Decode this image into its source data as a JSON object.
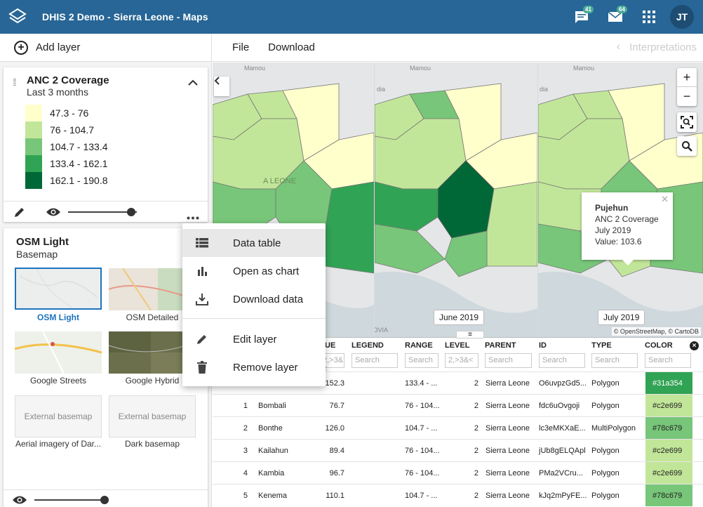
{
  "app": {
    "title": "DHIS 2 Demo - Sierra Leone - Maps",
    "messages_count": "41",
    "mail_count": "64",
    "user_initials": "JT"
  },
  "left_panel": {
    "add_layer": "Add layer",
    "thematic_layer": {
      "title": "ANC 2 Coverage",
      "period": "Last 3 months",
      "legend": [
        {
          "label": "47.3 - 76",
          "color": "#ffffcc"
        },
        {
          "label": "76 - 104.7",
          "color": "#c2e699"
        },
        {
          "label": "104.7 - 133.4",
          "color": "#78c679"
        },
        {
          "label": "133.4 - 162.1",
          "color": "#31a354"
        },
        {
          "label": "162.1 - 190.8",
          "color": "#006837"
        }
      ]
    },
    "basemap_card": {
      "title": "OSM Light",
      "subtitle": "Basemap",
      "basemaps": [
        {
          "label": "OSM Light",
          "selected": true
        },
        {
          "label": "OSM Detailed"
        },
        {
          "label": "Google Streets"
        },
        {
          "label": "Google Hybrid"
        },
        {
          "label": "Aerial imagery of Dar...",
          "thumb_text": "External basemap"
        },
        {
          "label": "Dark basemap",
          "thumb_text": "External basemap"
        }
      ]
    }
  },
  "toolbar": {
    "file": "File",
    "download": "Download",
    "interpretations": "Interpretations"
  },
  "context_menu": {
    "items": [
      {
        "label": "Data table",
        "icon": "table-icon"
      },
      {
        "label": "Open as chart",
        "icon": "chart-icon"
      },
      {
        "label": "Download data",
        "icon": "download-icon"
      },
      {
        "label": "Edit layer",
        "icon": "pencil-icon"
      },
      {
        "label": "Remove layer",
        "icon": "trash-icon"
      }
    ]
  },
  "map": {
    "periods": [
      "June 2019",
      "July 2019"
    ],
    "place_labels": {
      "mamou": "Mamou",
      "monrovia": "MONROVIA",
      "dia": "dia",
      "leone": "A LEONE"
    },
    "attribution": "© OpenStreetMap, © CartoDB",
    "popup": {
      "name": "Pujehun",
      "layer": "ANC 2 Coverage",
      "period": "July 2019",
      "value": "Value: 103.6"
    }
  },
  "table": {
    "headers": [
      "UE",
      "LEGEND",
      "RANGE",
      "LEVEL",
      "PARENT",
      "ID",
      "TYPE",
      "COLOR"
    ],
    "filters": {
      "value": "2,>3&<",
      "legend": "Search",
      "range": "Search",
      "level": "2,>3&<",
      "parent": "Search",
      "id": "Search",
      "type": "Search",
      "color": "Search"
    },
    "rows": [
      {
        "index": "",
        "name": "",
        "value": "152.3",
        "range": "133.4 - ...",
        "level": "2",
        "parent": "Sierra Leone",
        "id": "O6uvpzGd5...",
        "type": "Polygon",
        "color": "#31a354"
      },
      {
        "index": "1",
        "name": "Bombali",
        "value": "76.7",
        "range": "76 - 104...",
        "level": "2",
        "parent": "Sierra Leone",
        "id": "fdc6uOvgoji",
        "type": "Polygon",
        "color": "#c2e699"
      },
      {
        "index": "2",
        "name": "Bonthe",
        "value": "126.0",
        "range": "104.7 - ...",
        "level": "2",
        "parent": "Sierra Leone",
        "id": "lc3eMKXaE...",
        "type": "MultiPolygon",
        "color": "#78c679"
      },
      {
        "index": "3",
        "name": "Kailahun",
        "value": "89.4",
        "range": "76 - 104...",
        "level": "2",
        "parent": "Sierra Leone",
        "id": "jUb8gELQApl",
        "type": "Polygon",
        "color": "#c2e699"
      },
      {
        "index": "4",
        "name": "Kambia",
        "value": "96.7",
        "range": "76 - 104...",
        "level": "2",
        "parent": "Sierra Leone",
        "id": "PMa2VCru...",
        "type": "Polygon",
        "color": "#c2e699"
      },
      {
        "index": "5",
        "name": "Kenema",
        "value": "110.1",
        "range": "104.7 - ...",
        "level": "2",
        "parent": "Sierra Leone",
        "id": "kJq2mPyFE...",
        "type": "Polygon",
        "color": "#78c679"
      }
    ]
  }
}
